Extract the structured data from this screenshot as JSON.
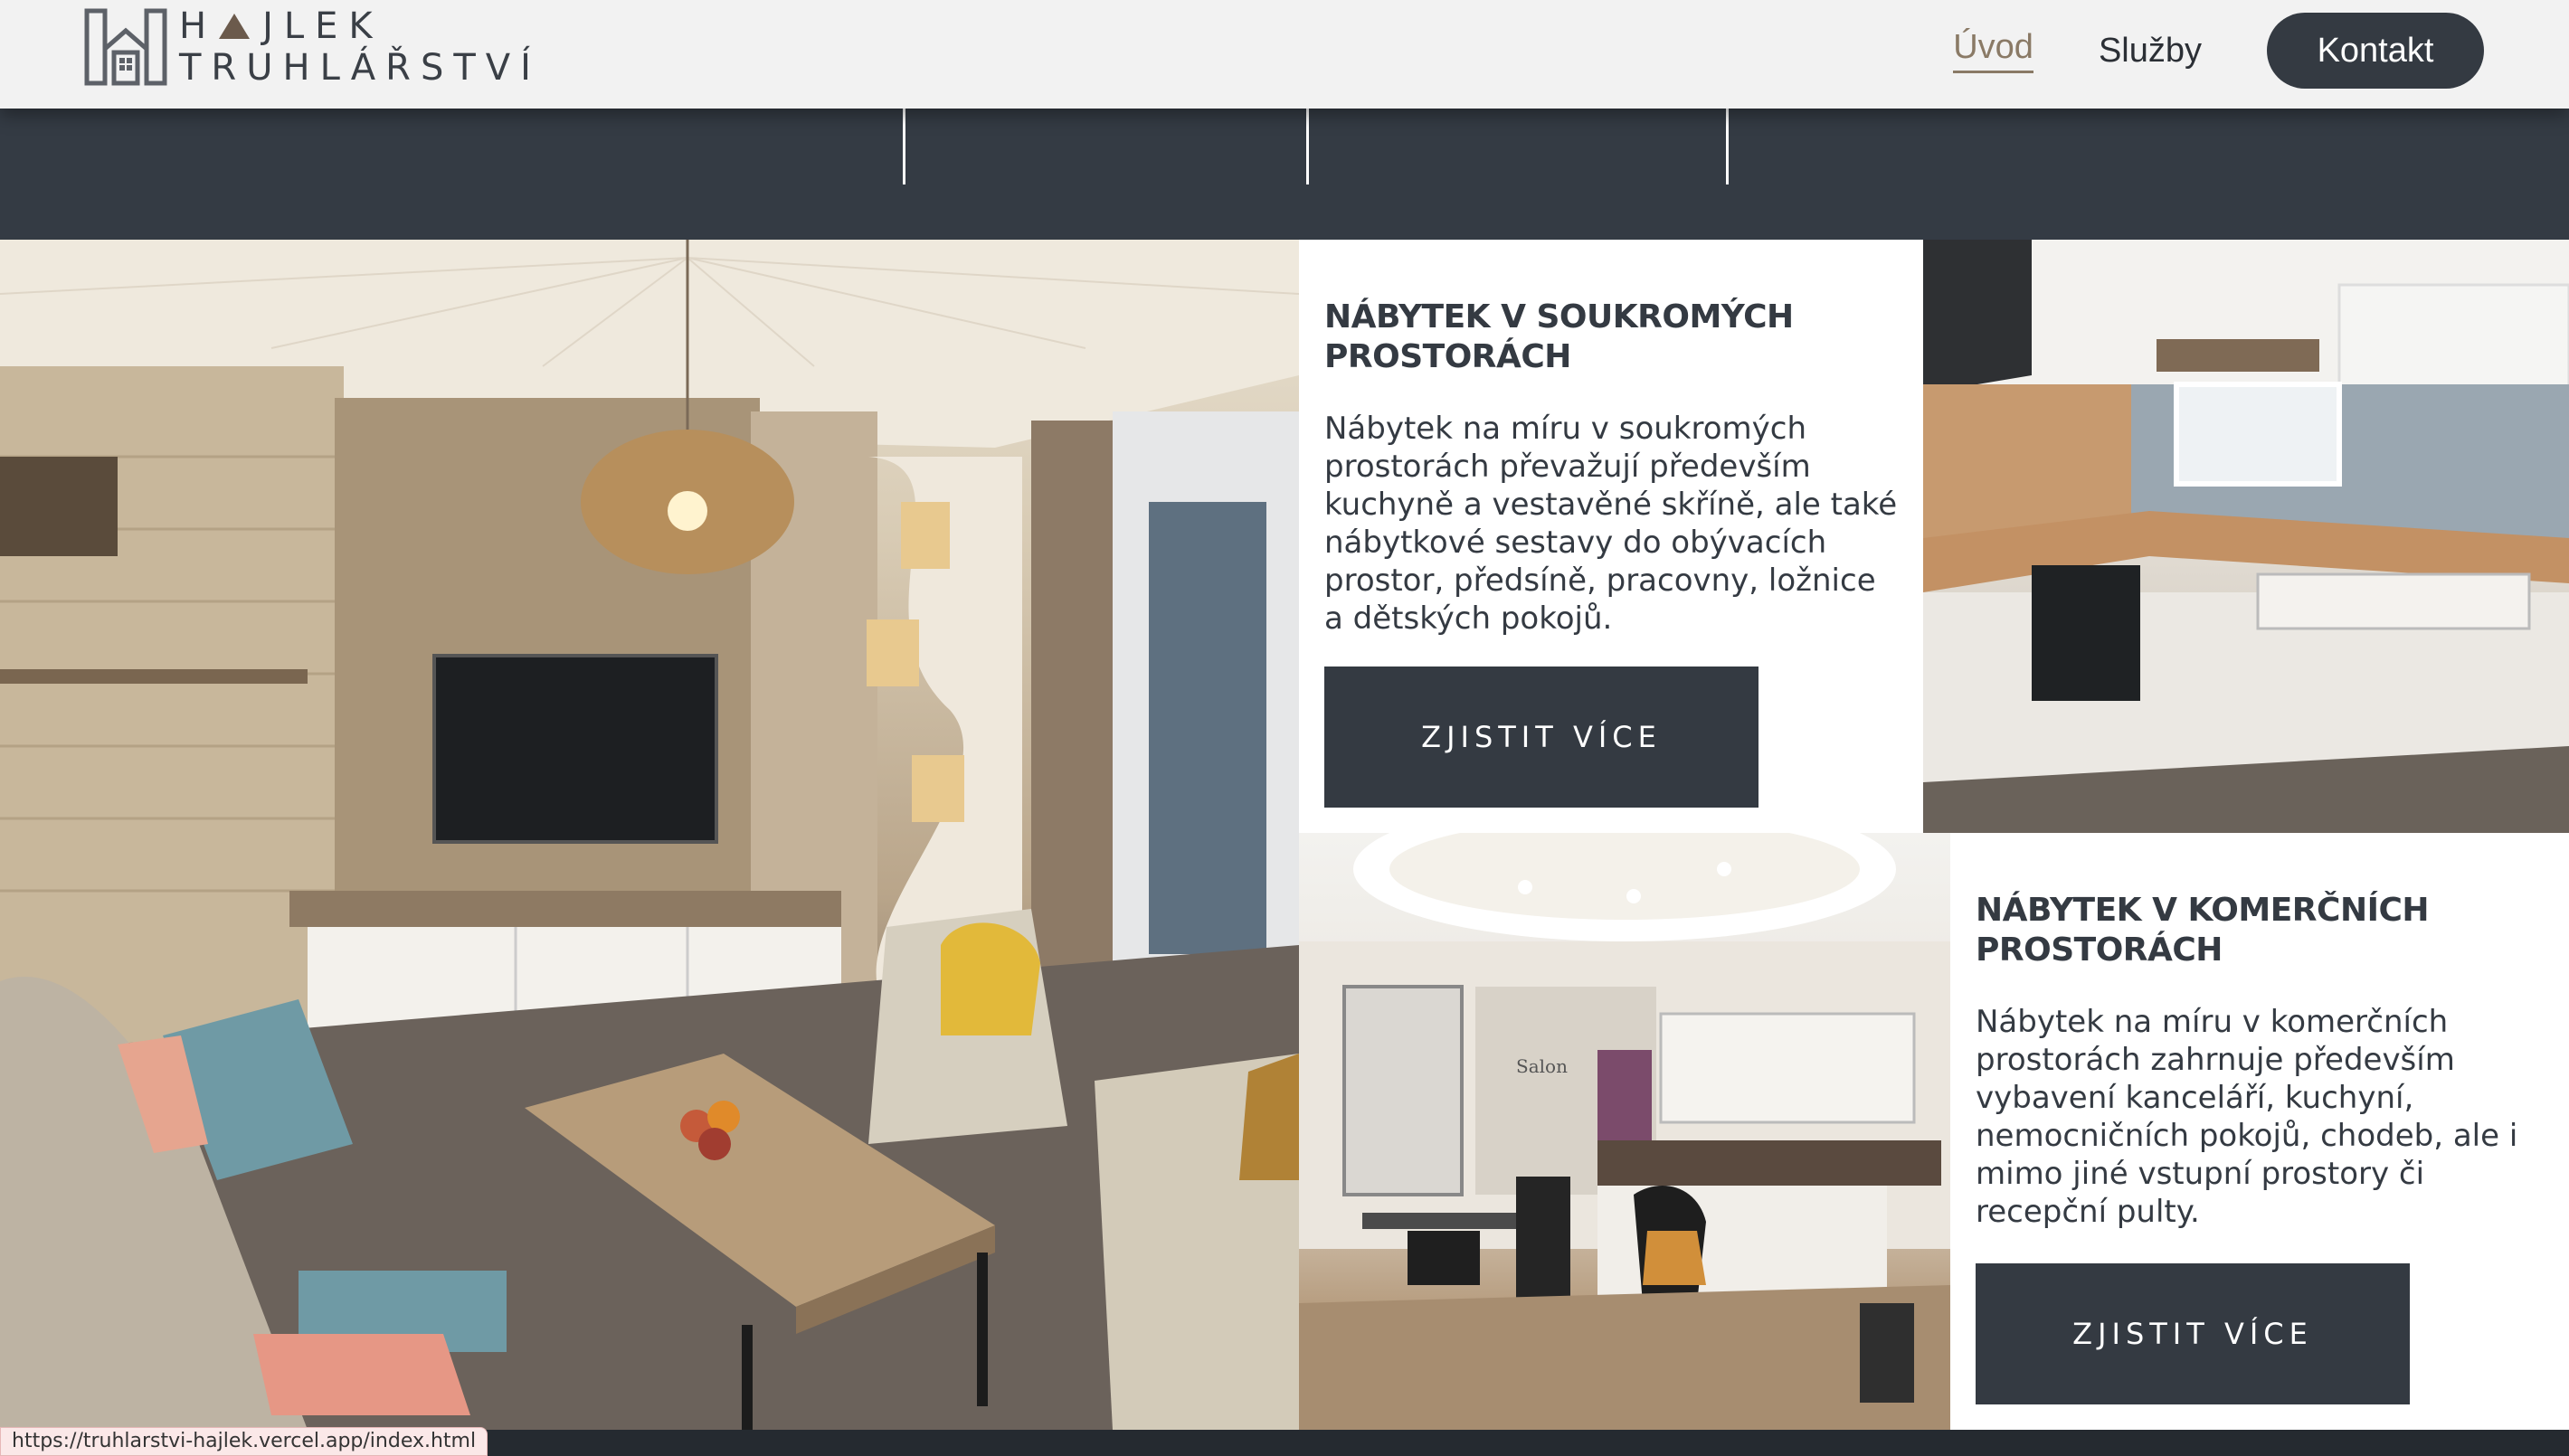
{
  "brand": {
    "name_line1_a": "H",
    "name_line1_b": "JLEK",
    "name_line2": "TRUHLÁŘSTVÍ"
  },
  "nav": {
    "items": [
      {
        "label": "Úvod",
        "active": true
      },
      {
        "label": "Služby",
        "active": false
      }
    ],
    "cta_label": "Kontakt"
  },
  "sections": {
    "private": {
      "title": "NÁBYTEK V SOUKROMÝCH PROSTORÁCH",
      "text": "Nábytek na míru v soukromých prostorách převažují především kuchyně a vestavěné skříně, ale také nábytkové sestavy do obývacích prostor, předsíně, pracovny, ložnice a dětských pokojů.",
      "button_label": "ZJISTIT VÍCE"
    },
    "commercial": {
      "title": "NÁBYTEK V KOMERČNÍCH PROSTORÁCH",
      "text": "Nábytek na míru v komerčních prostorách zahrnuje především vybavení kanceláří, kuchyní, nemocničních pokojů, chodeb, ale i mimo jiné vstupní prostory či recepční pulty.",
      "button_label": "ZJISTIT VÍCE"
    }
  },
  "photo_labels": {
    "salon_sign": "Salon"
  },
  "status_url": "https://truhlarstvi-hajlek.vercel.app/index.html",
  "colors": {
    "dark": "#343a42",
    "accent": "#8a7a66",
    "header_bg": "#f2f2f2"
  }
}
